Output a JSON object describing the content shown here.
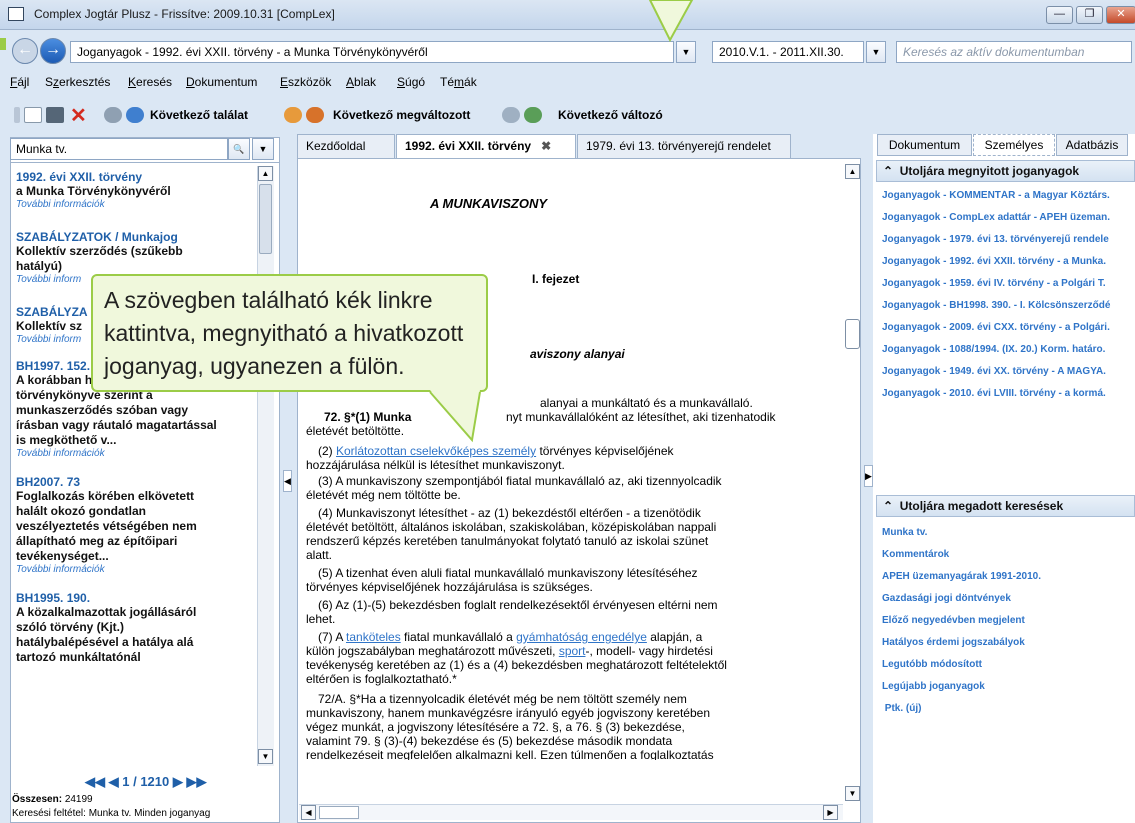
{
  "window": {
    "title": "Complex Jogtár Plusz - Frissítve: 2009.10.31 [CompLex]"
  },
  "address": {
    "document": "Joganyagok - 1992. évi XXII. törvény - a Munka Törvénykönyvéről",
    "period": "2010.V.1. - 2011.XII.30.",
    "search_placeholder": "Keresés az aktív dokumentumban"
  },
  "menu": [
    {
      "pre": "",
      "u": "F",
      "post": "ájl"
    },
    {
      "pre": "S",
      "u": "z",
      "post": "erkesztés"
    },
    {
      "pre": "",
      "u": "K",
      "post": "eresés"
    },
    {
      "pre": "",
      "u": "D",
      "post": "okumentum"
    },
    {
      "pre": "",
      "u": "E",
      "post": "szközök"
    },
    {
      "pre": "",
      "u": "A",
      "post": "blak"
    },
    {
      "pre": "",
      "u": "S",
      "post": "úgó"
    },
    {
      "pre": "Té",
      "u": "m",
      "post": "ák"
    }
  ],
  "toolbar": {
    "next_hit": "Következő találat",
    "next_changed": "Következő megváltozott",
    "next_change": "Következő változó"
  },
  "left": {
    "search_value": "Munka tv.",
    "results": [
      {
        "title": "1992. évi XXII. törvény",
        "body": [
          "a Munka Törvénykönyvéről"
        ],
        "more": "További információk"
      },
      {
        "title": "SZABÁLYZATOK / Munkajog",
        "body": [
          "Kollektív szerződés (szűkebb",
          "hatályú)"
        ],
        "more": "További inform"
      },
      {
        "title": "SZABÁLYZA",
        "body": [
          "Kollektív sz"
        ],
        "more": "További inform"
      },
      {
        "title": "BH1997. 152.",
        "body": [
          "A korábban hatályos Munka",
          "törvénykönyve szerint a",
          "munkaszerződés szóban vagy",
          "írásban vagy ráutaló magatartással",
          "is megköthető v..."
        ],
        "more": "További információk"
      },
      {
        "title": "BH2007. 73",
        "body": [
          "Foglalkozás körében elkövetett",
          "halált okozó gondatlan",
          "veszélyeztetés vétségében nem",
          "állapítható meg az építőipari",
          "tevékenységet..."
        ],
        "more": "További információk"
      },
      {
        "title": "BH1995. 190.",
        "body": [
          "A közalkalmazottak jogállásáról",
          "szóló törvény (Kjt.)",
          "hatálybalépésével a hatálya alá",
          "tartozó munkáltatónál"
        ],
        "more": ""
      }
    ],
    "pager": "1 / 1210",
    "total_label": "Összesen:",
    "total": "24199",
    "criteria": "Keresési feltétel:  Munka tv.  Minden joganyag"
  },
  "tabs": [
    {
      "label": "Kezdőoldal"
    },
    {
      "label": "1992. évi XXII. törvény"
    },
    {
      "label": "1979. évi 13. törvényerejű rendelet"
    }
  ],
  "doc": {
    "heading": "A MUNKAVISZONY",
    "chapter": "I. fejezet",
    "section": "aviszony alanyai",
    "lines": {
      "l71": "alanyai a munkáltató és a munkavállaló.",
      "l72": "72. §*(1) Munka",
      "l72b": "nyt munkavállalóként az létesíthet, aki tizenhatodik",
      "p1": "életévét betöltötte.",
      "p2_pre": "(2) ",
      "p2_link": "Korlátozottan cselekvőképes személy",
      "p2_post": " törvényes képviselőjének",
      "p3": "hozzájárulása nélkül is létesíthet munkaviszonyt.",
      "p4": "(3) A munkaviszony szempontjából fiatal munkavállaló az, aki tizennyolcadik",
      "p5": "életévét még nem töltötte be.",
      "p6": "(4) Munkaviszonyt létesíthet - az (1) bekezdéstől eltérően - a tizenötödik",
      "p7": "életévét betöltött, általános iskolában, szakiskolában, középiskolában nappali",
      "p8": "rendszerű képzés keretében tanulmányokat folytató tanuló az iskolai szünet",
      "p9": "alatt.",
      "p10": "(5) A tizenhat éven aluli fiatal munkavállaló munkaviszony létesítéséhez",
      "p11": "törvényes képviselőjének hozzájárulása is szükséges.",
      "p12": "(6) Az (1)-(5) bekezdésben foglalt rendelkezésektől érvényesen eltérni nem",
      "p13": "lehet.",
      "p14_pre": "(7) A ",
      "p14_link1": "tanköteles",
      "p14_mid": " fiatal munkavállaló a ",
      "p14_link2": "gyámhatóság engedélye",
      "p14_post": " alapján, a",
      "p15_pre": "külön jogszabályban meghatározott művészeti, ",
      "p15_link": "sport",
      "p15_post": "-, modell- vagy hirdetési",
      "p16": "tevékenység keretében az (1) és a (4) bekezdésben meghatározott feltételektől",
      "p17": "eltérően is foglalkoztatható.*",
      "p18": "72/A. §*Ha a tizennyolcadik életévét még be nem töltött személy nem",
      "p19": "munkaviszony, hanem munkavégzésre irányuló egyéb jogviszony keretében",
      "p20": "végez munkát, a jogviszony létesítésére a 72. §, a 76. § (3) bekezdése,",
      "p21": "valamint 79. § (3)-(4) bekezdése és (5) bekezdése második mondata",
      "p22": "rendelkezéseit megfelelően alkalmazni kell. Ezen túlmenően a foglalkoztatás"
    }
  },
  "right": {
    "tabs": [
      "Dokumentum",
      "Személyes",
      "Adatbázis"
    ],
    "recent_header": "Utoljára megnyitott joganyagok",
    "recent": [
      "Joganyagok - KOMMENTÁR - a Magyar Köztárs.",
      "Joganyagok - CompLex adattár - APEH üzeman.",
      "Joganyagok - 1979. évi 13. törvényerejű rendele",
      "Joganyagok - 1992. évi XXII. törvény - a Munka.",
      "Joganyagok - 1959. évi IV. törvény - a Polgári T.",
      "Joganyagok - BH1998. 390. - I. Kölcsönszerződé",
      "Joganyagok - 2009. évi CXX. törvény - a Polgári.",
      "Joganyagok - 1088/1994. (IX. 20.) Korm. határo.",
      "Joganyagok - 1949. évi XX. törvény - A MAGYA.",
      "Joganyagok - 2010. évi LVIII. törvény - a kormá."
    ],
    "searches_header": "Utoljára megadott keresések",
    "searches": [
      "Munka tv.",
      "Kommentárok",
      "APEH üzemanyagárak 1991-2010.",
      "Gazdasági jogi döntvények",
      "Előző negyedévben megjelent",
      "Hatályos érdemi jogszabályok",
      "Legutóbb módosított",
      "Legújabb joganyagok",
      " Ptk. (új)"
    ]
  },
  "callout": {
    "lines": [
      "A szövegben található kék linkre",
      "kattintva, megnyitható a hivatkozott",
      "joganyag, ugyanezen a fülön."
    ]
  }
}
